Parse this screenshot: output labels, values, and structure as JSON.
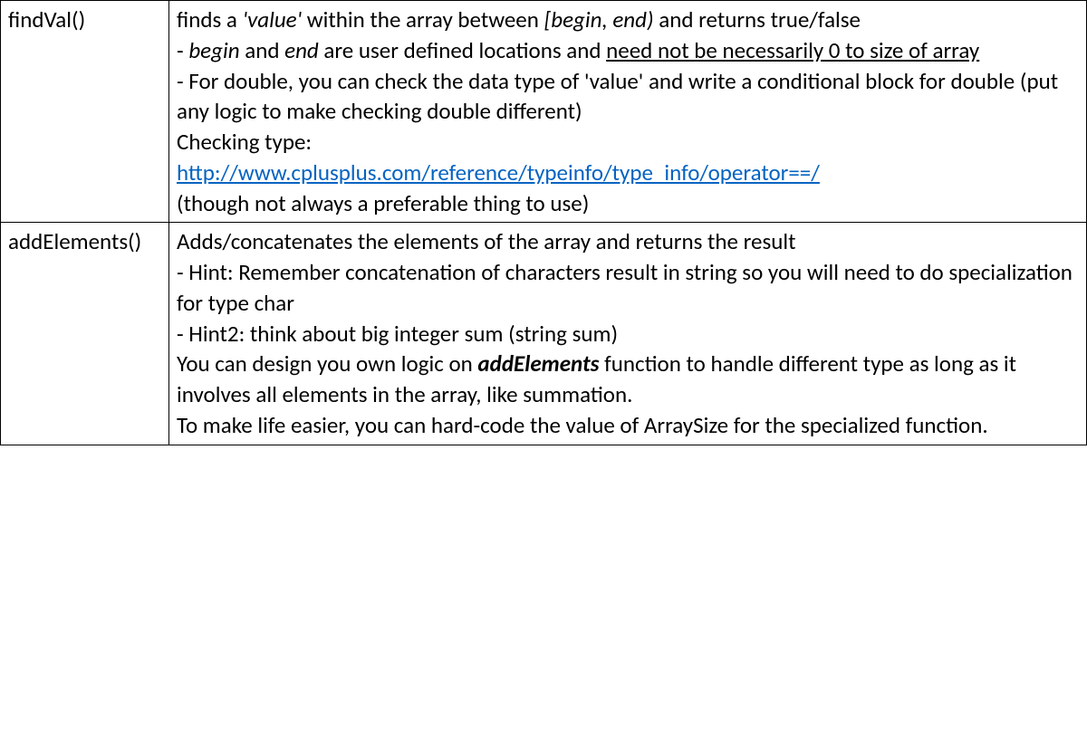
{
  "rows": [
    {
      "name": "findVal()",
      "lines": {
        "l1a": "finds a ",
        "l1b": "'value'",
        "l1c": " within the array between ",
        "l1d": "[begin, end)",
        "l1e": " and returns true/false",
        "l2a": "- ",
        "l2b": "begin",
        "l2c": " and ",
        "l2d": "end",
        "l2e": " are user defined locations and ",
        "l2f": "need not be necessarily 0 to size of array",
        "l3": "- For double, you can check the data type of 'value' and write a conditional block for double (put any logic to make checking double different)",
        "l4": "Checking type:",
        "l5": "http://www.cplusplus.com/reference/typeinfo/type_info/operator==/",
        "l6": "(though not always a preferable thing to use)"
      }
    },
    {
      "name": "addElements()",
      "lines": {
        "l1": "Adds/concatenates the elements of the array and returns the result",
        "l2": "- Hint: Remember concatenation of characters result in string so you will need to do specialization for type char",
        "l3": "- Hint2: think about big integer sum (string sum)",
        "l4a": "You can design you own logic on ",
        "l4b": "addElements",
        "l4c": " function to handle different type as long as it involves all elements in the array, like summation.",
        "l5": "To make life easier, you can hard-code the value of ArraySize for the specialized function."
      }
    }
  ]
}
